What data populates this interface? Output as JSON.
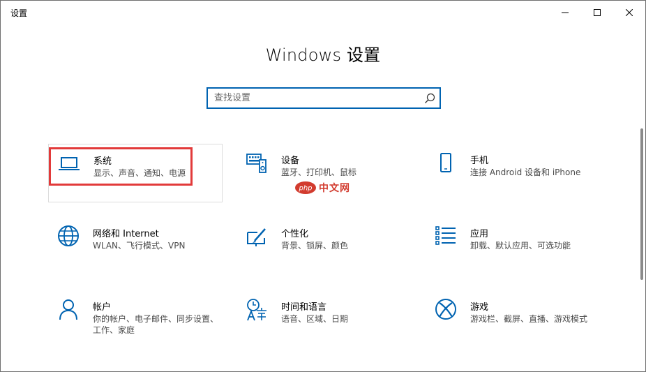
{
  "window": {
    "title": "设置"
  },
  "heading": "Windows 设置",
  "search": {
    "placeholder": "查找设置",
    "icon": "search-icon"
  },
  "accent_color": "#0063b1",
  "tiles": [
    {
      "title": "系统",
      "desc": "显示、声音、通知、电源",
      "icon": "laptop-icon"
    },
    {
      "title": "设备",
      "desc": "蓝牙、打印机、鼠标",
      "icon": "keyboard-speaker-icon"
    },
    {
      "title": "手机",
      "desc": "连接 Android 设备和 iPhone",
      "icon": "phone-icon"
    },
    {
      "title": "网络和 Internet",
      "desc": "WLAN、飞行模式、VPN",
      "icon": "globe-icon"
    },
    {
      "title": "个性化",
      "desc": "背景、锁屏、颜色",
      "icon": "paint-brush-icon"
    },
    {
      "title": "应用",
      "desc": "卸载、默认应用、可选功能",
      "icon": "apps-list-icon"
    },
    {
      "title": "帐户",
      "desc": "你的帐户、电子邮件、同步设置、工作、家庭",
      "icon": "person-icon"
    },
    {
      "title": "时间和语言",
      "desc": "语音、区域、日期",
      "icon": "time-language-icon"
    },
    {
      "title": "游戏",
      "desc": "游戏栏、截屏、直播、游戏模式",
      "icon": "xbox-icon"
    }
  ],
  "watermark": {
    "text": "中文网",
    "logo": "php"
  }
}
